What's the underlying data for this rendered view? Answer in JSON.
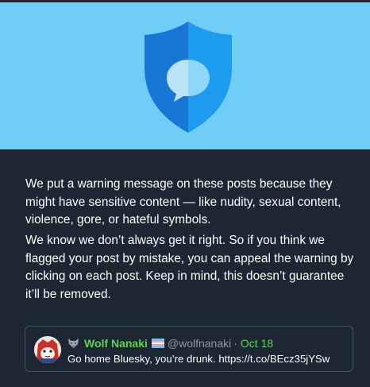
{
  "hero": {
    "icon": "shield-chat-icon",
    "colors": {
      "background": "#6fcdf6",
      "shield_left": "#1776d6",
      "shield_right": "#1d9bf0",
      "bubble_left": "#b8e3f9",
      "bubble_right": "#8ed7fa"
    }
  },
  "message": {
    "paragraph_1": "We put a warning message on these posts because they might have sensitive content — like nudity, sexual content, violence, gore, or hateful symbols.",
    "paragraph_2": "We know we don’t always get it right. So if you think we flagged your post by mistake, you can appeal the warning by clicking on each post. Keep in mind, this doesn’t guarantee it’ll be removed."
  },
  "post": {
    "display_name": "Wolf Nanaki",
    "name_emoji": "wolf-icon",
    "flag_emoji": "transgender-flag-icon",
    "handle": "@wolfnanaki",
    "separator": "·",
    "date": "Oct 18",
    "text": "Go home Bluesky, you’re drunk. https://t.co/BEcz35jYSw",
    "colors": {
      "name": "#62d053",
      "handle": "#8899a6",
      "text": "#ffffff",
      "border": "#3f5566"
    }
  }
}
